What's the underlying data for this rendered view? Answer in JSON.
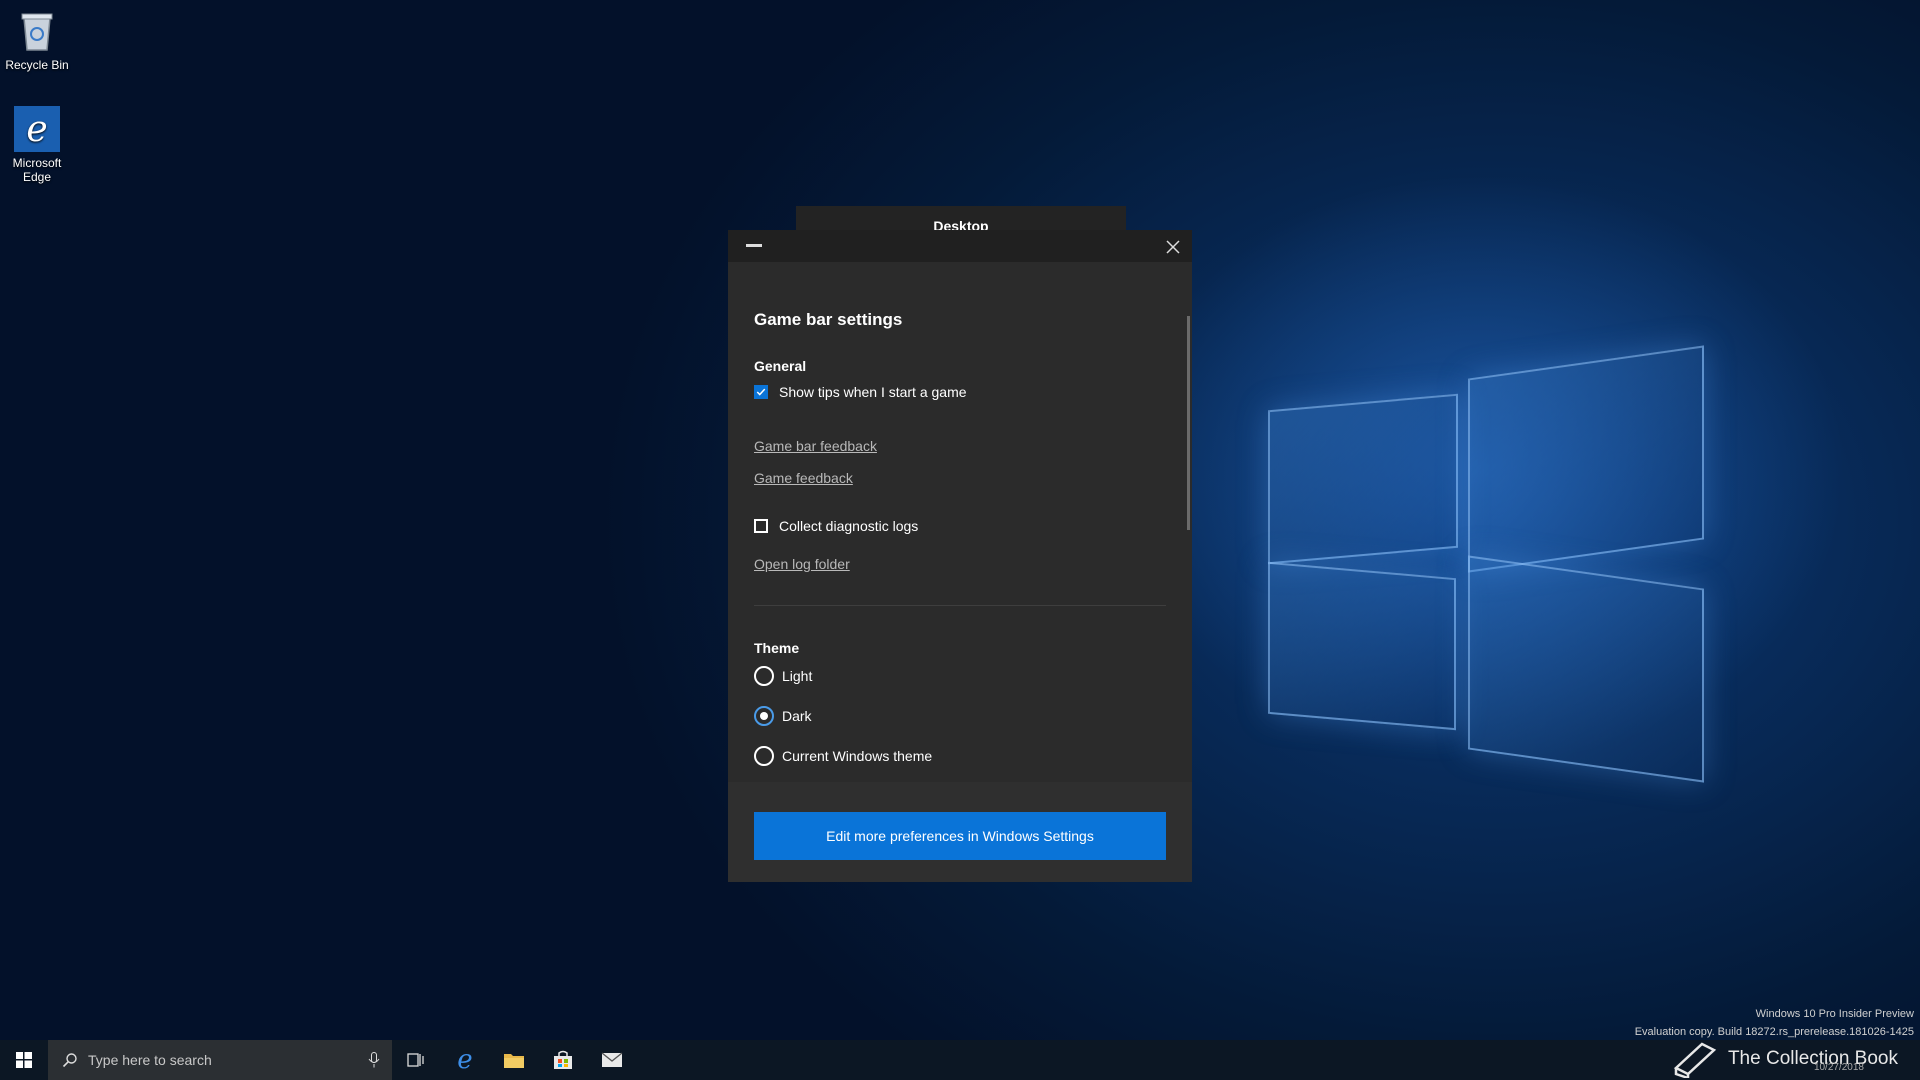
{
  "desktop": {
    "icons": [
      {
        "label": "Recycle Bin"
      },
      {
        "label": "Microsoft Edge"
      }
    ],
    "overlay_title": "Desktop"
  },
  "dialog": {
    "title": "Game bar settings",
    "general": {
      "heading": "General",
      "show_tips": {
        "label": "Show tips when I start a game",
        "checked": true
      },
      "game_bar_feedback": "Game bar feedback",
      "game_feedback": "Game feedback",
      "collect_logs": {
        "label": "Collect diagnostic logs",
        "checked": false
      },
      "open_log_folder": "Open log folder"
    },
    "theme": {
      "heading": "Theme",
      "options": [
        {
          "label": "Light",
          "selected": false
        },
        {
          "label": "Dark",
          "selected": true
        },
        {
          "label": "Current Windows theme",
          "selected": false
        }
      ]
    },
    "settings_button": "Edit more preferences in Windows Settings"
  },
  "taskbar": {
    "search_placeholder": "Type here to search",
    "icons": [
      "task-view-icon",
      "edge-icon",
      "file-explorer-icon",
      "store-icon",
      "mail-icon"
    ]
  },
  "watermark": {
    "line1": "Windows 10 Pro Insider Preview",
    "line2": "Evaluation copy. Build 18272.rs_prerelease.181026-1425",
    "brand": "The Collection Book",
    "date": "10/27/2018"
  },
  "colors": {
    "accent": "#0a74d8",
    "dialog_bg": "#2b2b2b"
  }
}
